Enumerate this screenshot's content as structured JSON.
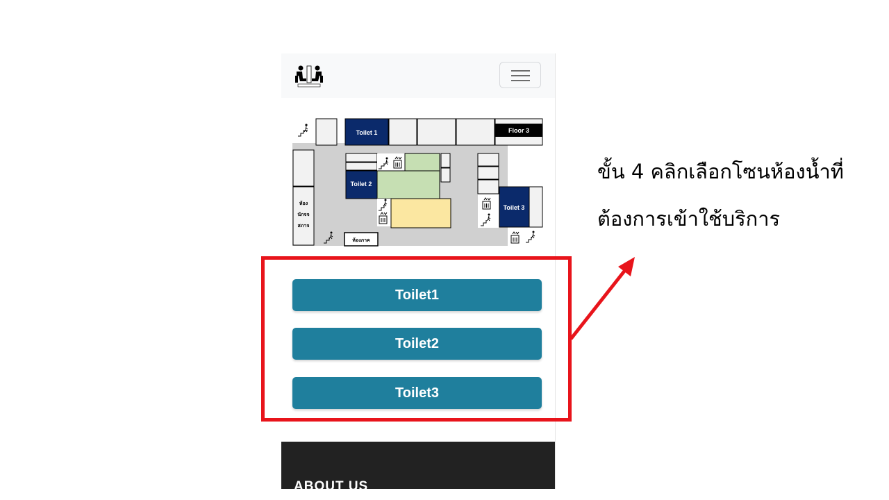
{
  "map": {
    "labels": {
      "toilet1": "Toilet 1",
      "toilet2": "Toilet 2",
      "toilet3": "Toilet 3",
      "floor3": "Floor 3",
      "room_left_line1": "ห้อง",
      "room_left_line2": "นักจจ",
      "room_left_line3": "สภาจ",
      "room_bottom": "ห้องภาค"
    },
    "colors": {
      "toilet": "#0b2a6b",
      "green_zone": "#c6dfb3",
      "yellow_zone": "#fbe7a1",
      "corridor": "#d0d0d0"
    }
  },
  "buttons": {
    "toilet1": "Toilet1",
    "toilet2": "Toilet2",
    "toilet3": "Toilet3",
    "color": "#1f7f9d"
  },
  "footer": {
    "title": "ABOUT US"
  },
  "instruction": {
    "line1": "ขั้น 4 คลิกเลือกโซนห้องน้ำที่",
    "line2": "ต้องการเข้าใช้บริการ"
  },
  "highlight_color": "#e8141b",
  "icons": [
    "logo-icon",
    "hamburger-menu-icon",
    "stairs-icon",
    "elevator-icon"
  ]
}
